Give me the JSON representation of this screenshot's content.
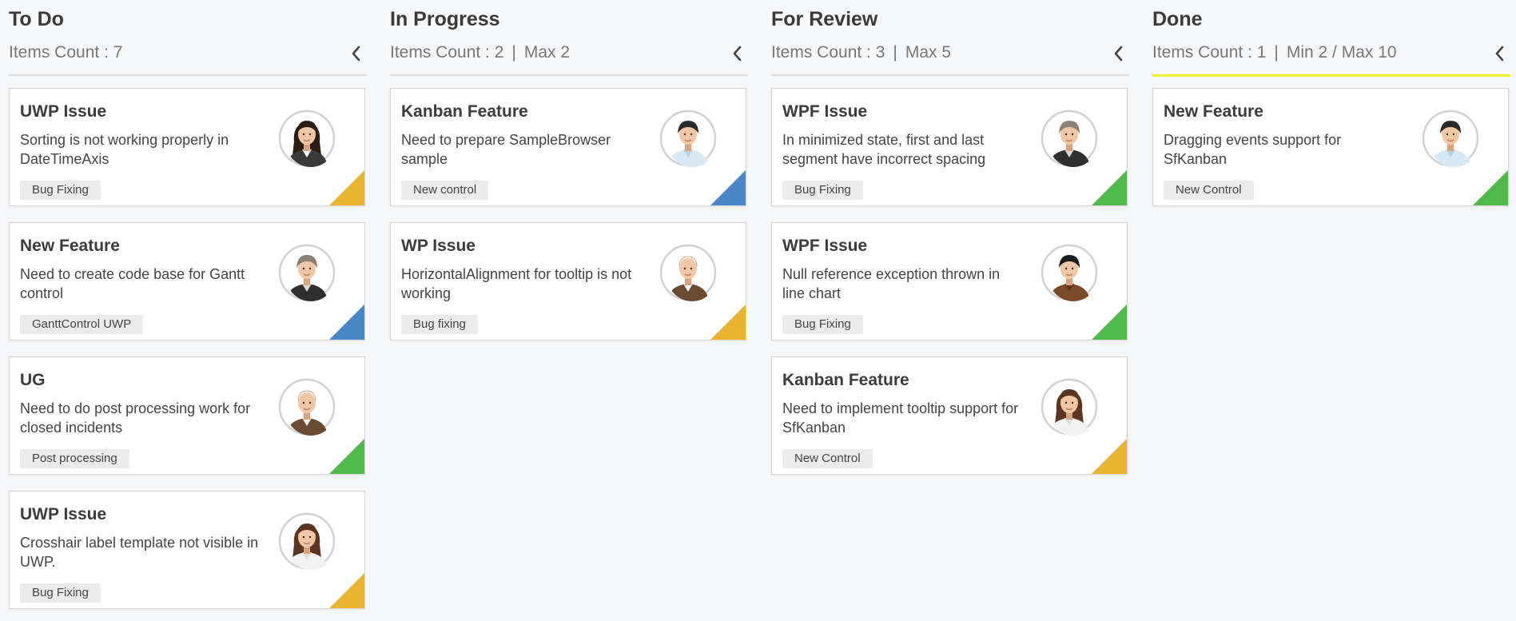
{
  "colors": {
    "warning": "#e9b432",
    "info": "#4a86c8",
    "success": "#4fba4a",
    "limit_line": "#f2f230"
  },
  "columns": [
    {
      "title": "To Do",
      "subtitle": "Items Count : 7",
      "limit": "",
      "toggle_icon": "chevron-left-icon",
      "cards": [
        {
          "title": "UWP Issue",
          "description": "Sorting is not working properly in DateTimeAxis",
          "tag": "Bug Fixing",
          "avatar": "female-avatar-1",
          "indicator": "warning"
        },
        {
          "title": "New Feature",
          "description": "Need to create code base for Gantt control",
          "tag": "GanttControl UWP",
          "avatar": "female-avatar-2",
          "indicator": "info"
        },
        {
          "title": "UG",
          "description": "Need to do post processing work for closed incidents",
          "tag": "Post processing",
          "avatar": "male-avatar-bald",
          "indicator": "success"
        },
        {
          "title": "UWP Issue",
          "description": "Crosshair label template not visible in UWP.",
          "tag": "Bug Fixing",
          "avatar": "female-avatar-3",
          "indicator": "warning"
        }
      ]
    },
    {
      "title": "In Progress",
      "subtitle": "Items Count : 2",
      "limit": "Max 2",
      "toggle_icon": "chevron-left-icon",
      "cards": [
        {
          "title": "Kanban Feature",
          "description": "Need to prepare SampleBrowser sample",
          "tag": "New control",
          "avatar": "male-avatar-1",
          "indicator": "info"
        },
        {
          "title": "WP Issue",
          "description": "HorizontalAlignment for tooltip is not working",
          "tag": "Bug fixing",
          "avatar": "male-avatar-bald",
          "indicator": "warning"
        }
      ]
    },
    {
      "title": "For Review",
      "subtitle": "Items Count : 3",
      "limit": "Max 5",
      "toggle_icon": "chevron-left-icon",
      "cards": [
        {
          "title": "WPF Issue",
          "description": "In minimized state, first and last segment have incorrect spacing",
          "tag": "Bug Fixing",
          "avatar": "female-avatar-2",
          "indicator": "success"
        },
        {
          "title": "WPF Issue",
          "description": "Null reference exception thrown in line chart",
          "tag": "Bug Fixing",
          "avatar": "male-avatar-2",
          "indicator": "success"
        },
        {
          "title": "Kanban Feature",
          "description": "Need to implement tooltip support for SfKanban",
          "tag": "New Control",
          "avatar": "female-avatar-3",
          "indicator": "warning"
        }
      ]
    },
    {
      "title": "Done",
      "subtitle": "Items Count : 1",
      "limit": "Min 2 / Max 10",
      "toggle_icon": "chevron-left-icon",
      "cards": [
        {
          "title": "New Feature",
          "description": "Dragging events support for SfKanban",
          "tag": "New Control",
          "avatar": "male-avatar-1",
          "indicator": "success"
        }
      ]
    }
  ]
}
